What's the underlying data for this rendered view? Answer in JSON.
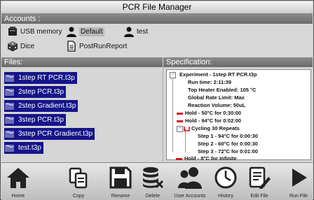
{
  "window": {
    "title": "PCR File Manager"
  },
  "accounts": {
    "header": "Accounts :",
    "items": [
      {
        "label": "USB memory",
        "icon": "usb-memory-icon"
      },
      {
        "label": "Default",
        "icon": "user-icon",
        "selected": true
      },
      {
        "label": "test",
        "icon": "user-icon"
      },
      {
        "label": "Dice",
        "icon": "dice-icon"
      },
      {
        "label": "PostRunReport",
        "icon": "document-icon"
      }
    ]
  },
  "files": {
    "header": "Files:",
    "items": [
      {
        "label": "1step RT PCR.t3p"
      },
      {
        "label": "2step PCR.t3p"
      },
      {
        "label": "2step Gradient.t3p"
      },
      {
        "label": "3step PCR.t3p"
      },
      {
        "label": "3step PCR Gradient.t3p"
      },
      {
        "label": "test.t3p"
      }
    ]
  },
  "specification": {
    "header": "Specification:",
    "lines": [
      {
        "text": "Experiment - 1step RT PCR.t3p"
      },
      {
        "text": "Run time: 2:11:39"
      },
      {
        "text": "Top Heater Enabled: 105 °C"
      },
      {
        "text": "Global Rate Limit: Max"
      },
      {
        "text": "Reaction Volume: 50uL"
      },
      {
        "text": "Hold - 50°C for 0:30:00"
      },
      {
        "text": "Hold - 94°C for 0:02:00"
      },
      {
        "text": "Cycling 30 Repeats"
      },
      {
        "text": "Step 1 - 94°C for 0:00:30"
      },
      {
        "text": "Step 2 - 60°C for 0:00:30"
      },
      {
        "text": "Step 3 - 72°C for 0:01:00"
      },
      {
        "text": "Hold - 8°C for Infinite"
      }
    ]
  },
  "toolbar": {
    "home": "Home",
    "copy": "Copy",
    "rename": "Rename",
    "delete": "Delete",
    "user_accounts": "User Accounts",
    "history": "History",
    "edit_file": "Edit File",
    "run_file": "Run File"
  },
  "colors": {
    "selection": "#15158a",
    "hold_marker": "#e01010",
    "header_bar": "#7a7a7a"
  }
}
